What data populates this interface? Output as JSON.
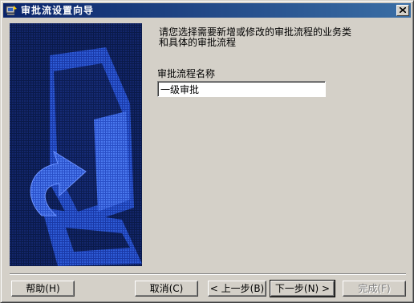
{
  "window": {
    "title": "审批流设置向导"
  },
  "content": {
    "instruction_line1": "请您选择需要新增或修改的审批流程的业务类",
    "instruction_line2": "和具体的审批流程",
    "field_label": "审批流程名称",
    "field_value": "一级审批"
  },
  "buttons": {
    "help": "帮助(H)",
    "cancel": "取消(C)",
    "back": "< 上一步(B)",
    "next": "下一步(N) >",
    "finish": "完成(F)"
  },
  "icons": {
    "app": "wizard-app-icon",
    "close": "close-icon",
    "wizard_art": "computer-arrow-illustration"
  },
  "colors": {
    "titlebar_start": "#0a246a",
    "titlebar_end": "#3a6ea5",
    "art_background": "#0a1a4a",
    "art_blue": "#2e5bd6"
  }
}
